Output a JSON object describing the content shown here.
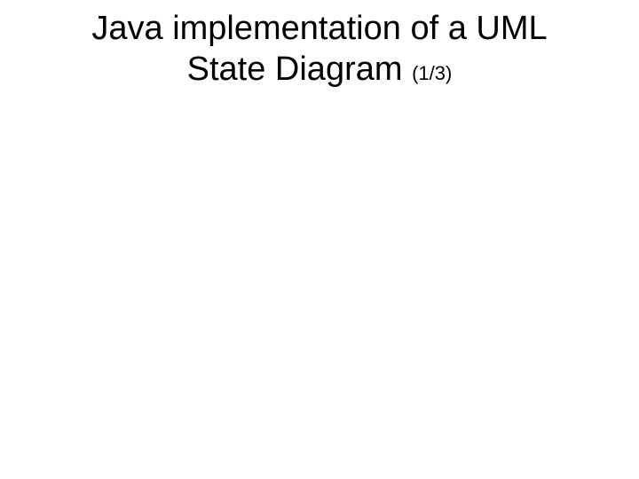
{
  "slide": {
    "title_line1": "Java implementation of a UML",
    "title_line2_main": "State Diagram ",
    "page_indicator": "(1/3)"
  }
}
